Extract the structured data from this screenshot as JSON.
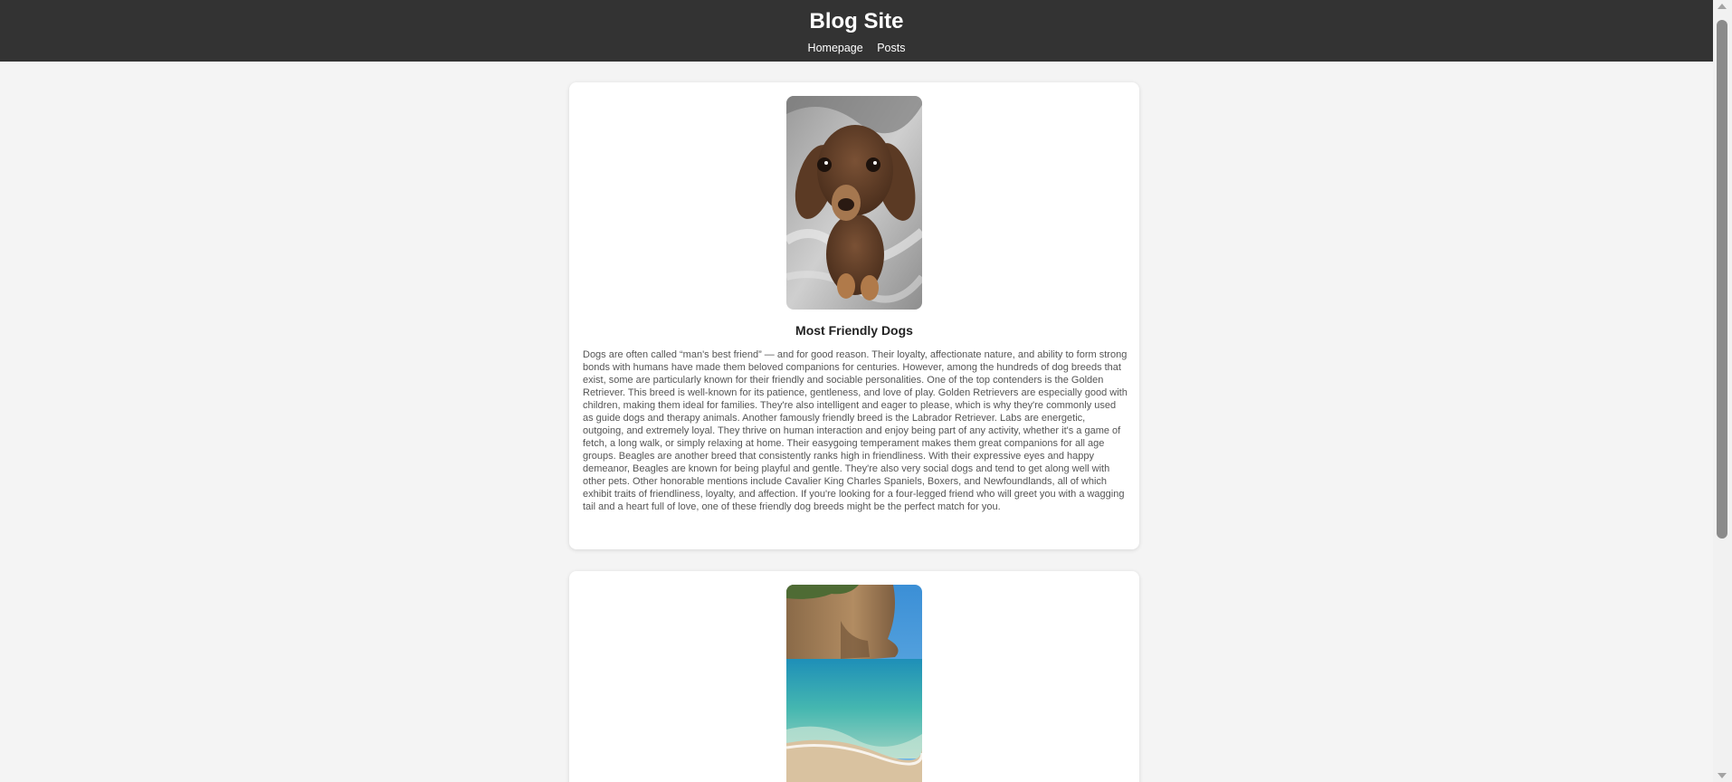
{
  "header": {
    "title": "Blog Site",
    "nav": [
      {
        "label": "Homepage"
      },
      {
        "label": "Posts"
      }
    ]
  },
  "posts": [
    {
      "title": "Most Friendly Dogs",
      "image_subject": "dachshund-puppy",
      "body": "Dogs are often called “man's best friend” — and for good reason. Their loyalty, affectionate nature, and ability to form strong bonds with humans have made them beloved companions for centuries. However, among the hundreds of dog breeds that exist, some are particularly known for their friendly and sociable personalities. One of the top contenders is the Golden Retriever. This breed is well-known for its patience, gentleness, and love of play. Golden Retrievers are especially good with children, making them ideal for families. They're also intelligent and eager to please, which is why they're commonly used as guide dogs and therapy animals. Another famously friendly breed is the Labrador Retriever. Labs are energetic, outgoing, and extremely loyal. They thrive on human interaction and enjoy being part of any activity, whether it's a game of fetch, a long walk, or simply relaxing at home. Their easygoing temperament makes them great companions for all age groups. Beagles are another breed that consistently ranks high in friendliness. With their expressive eyes and happy demeanor, Beagles are known for being playful and gentle. They're also very social dogs and tend to get along well with other pets. Other honorable mentions include Cavalier King Charles Spaniels, Boxers, and Newfoundlands, all of which exhibit traits of friendliness, loyalty, and affection. If you're looking for a four-legged friend who will greet you with a wagging tail and a heart full of love, one of these friendly dog breeds might be the perfect match for you."
    },
    {
      "image_subject": "beach-cliffs"
    }
  ],
  "colors": {
    "header_bg": "#333333",
    "page_bg": "#f4f4f4",
    "card_bg": "#ffffff",
    "body_text": "#555555",
    "title_text": "#222222"
  }
}
